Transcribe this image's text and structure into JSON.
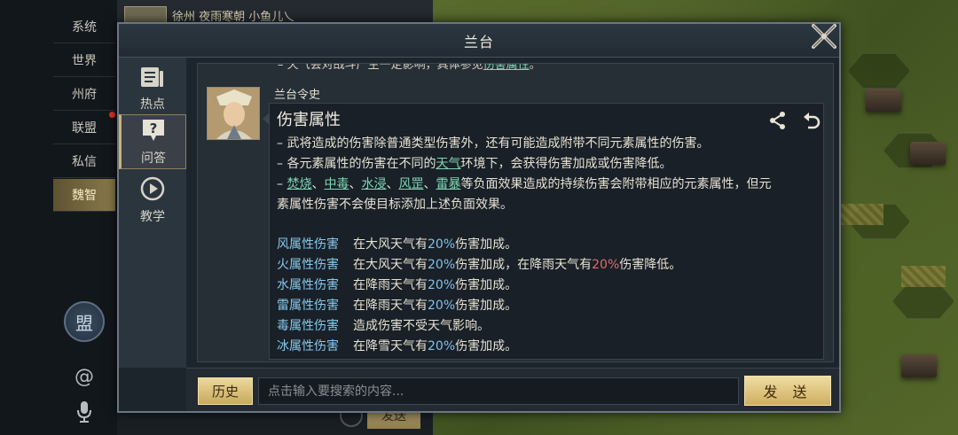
{
  "background_chat": {
    "top_text": "徐州 夜雨寒朝 小鱼儿乀",
    "send_label": "发送"
  },
  "left_nav": {
    "items": [
      {
        "label": "系统"
      },
      {
        "label": "世界"
      },
      {
        "label": "州府"
      },
      {
        "label": "联盟"
      },
      {
        "label": "私信"
      },
      {
        "label": "魏智"
      }
    ],
    "active_index": 5,
    "seal_label": "盟",
    "at_label": "@"
  },
  "dialog": {
    "title": "兰台",
    "tabs": [
      {
        "label": "热点"
      },
      {
        "label": "问答"
      },
      {
        "label": "教学"
      }
    ],
    "active_tab": 1
  },
  "message": {
    "prev_line_prefix": "– 天气会对战斗产生一定影响，具体参见",
    "prev_line_link": "伤害属性",
    "prev_line_suffix": "。",
    "sender": "兰台令史",
    "title": "伤害属性",
    "line1": "– 武将造成的伤害除普通类型伤害外，还有可能造成附带不同元素属性的伤害。",
    "line2_a": "– 各元素属性的伤害在不同的",
    "line2_link": "天气",
    "line2_b": "环境下，会获得伤害加成或伤害降低。",
    "line3_dash": "– ",
    "line3_links": [
      "焚烧",
      "中毒",
      "水浸",
      "风罡",
      "雷暴"
    ],
    "line3_sep": "、",
    "line3_b": "等负面效果造成的持续伤害会附带相应的元素属性，但元",
    "line4": "素属性伤害不会使目标添加上述负面效果。",
    "elements": [
      {
        "name": "风属性伤害",
        "pre": "在大风天气有",
        "pct": "20%",
        "post": "伤害加成。"
      },
      {
        "name": "火属性伤害",
        "pre": "在大风天气有",
        "pct": "20%",
        "post": "伤害加成，在降雨天气有",
        "pct2": "20%",
        "post2": "伤害降低。"
      },
      {
        "name": "水属性伤害",
        "pre": "在降雨天气有",
        "pct": "20%",
        "post": "伤害加成。"
      },
      {
        "name": "雷属性伤害",
        "pre": "在降雨天气有",
        "pct": "20%",
        "post": "伤害加成。"
      },
      {
        "name": "毒属性伤害",
        "pre": "造成伤害不受天气影响。"
      },
      {
        "name": "冰属性伤害",
        "pre": "在降雪天气有",
        "pct": "20%",
        "post": "伤害加成。"
      }
    ]
  },
  "input_bar": {
    "history_label": "历史",
    "placeholder": "点击输入要搜索的内容...",
    "send_label": "发 送"
  }
}
